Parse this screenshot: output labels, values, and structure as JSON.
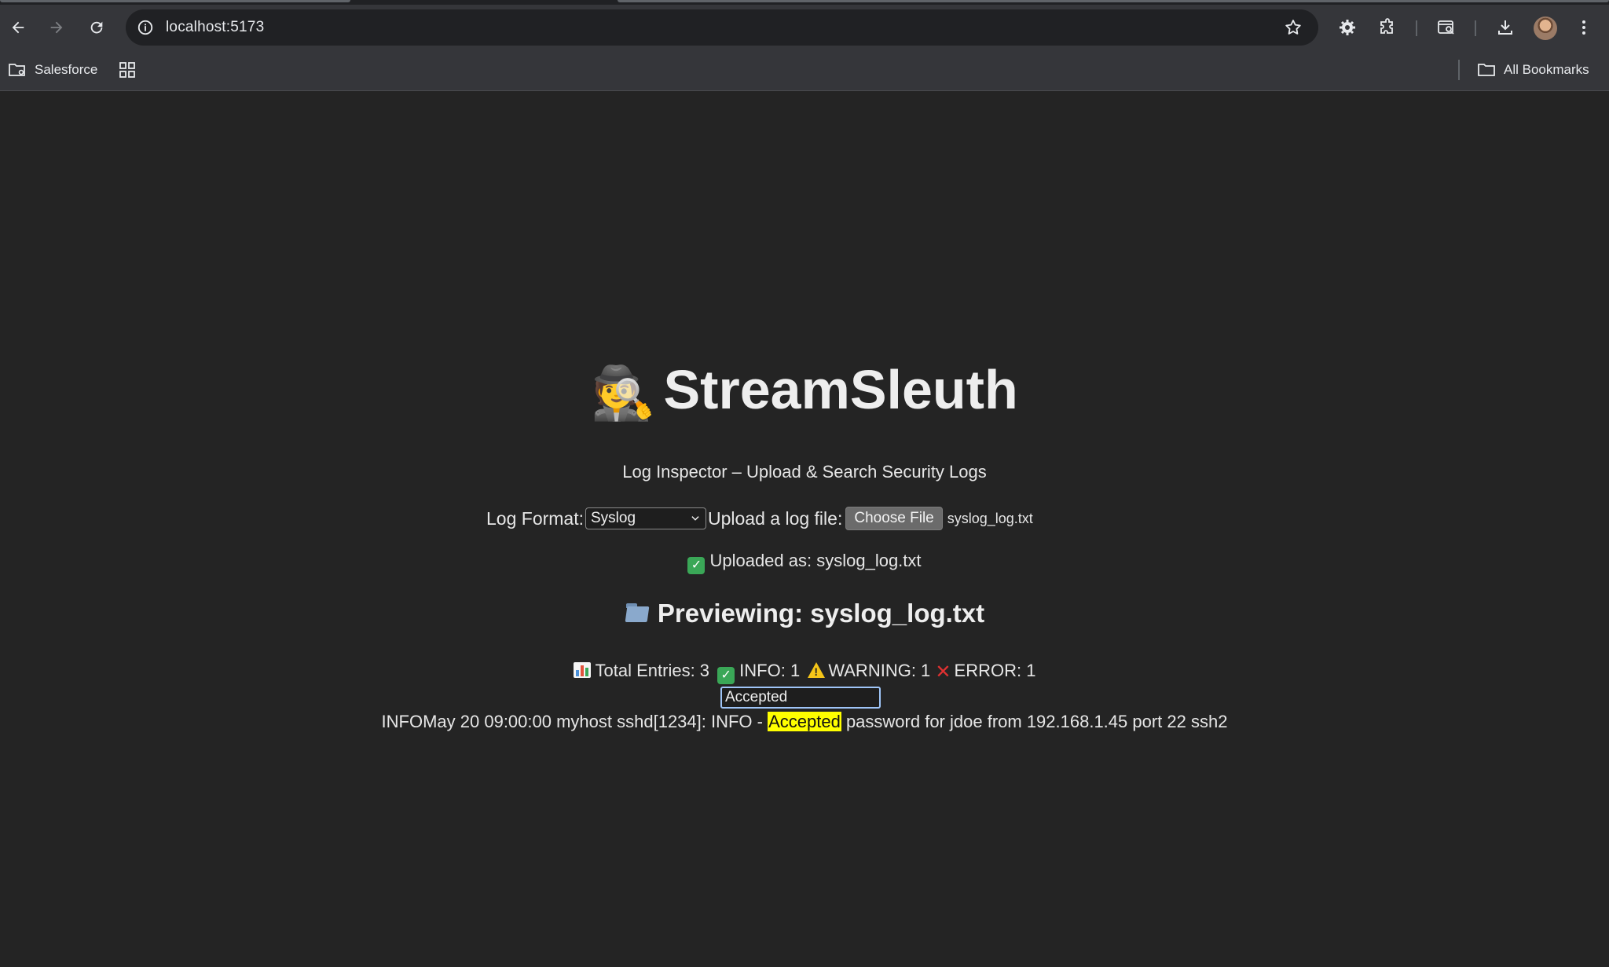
{
  "browser": {
    "url": "localhost:5173",
    "bookmarks": [
      {
        "label": "Salesforce",
        "icon": "folder-gear-icon"
      },
      {
        "label": "",
        "icon": "apps-grid-icon"
      }
    ],
    "all_bookmarks_label": "All Bookmarks"
  },
  "app": {
    "title_emoji": "🕵️",
    "title": "StreamSleuth",
    "subtitle": "Log Inspector – Upload & Search Security Logs"
  },
  "controls": {
    "format_label": "Log Format:",
    "format_value": "Syslog",
    "upload_label": "Upload a log file:",
    "choose_file_label": "Choose File",
    "file_name": "syslog_log.txt"
  },
  "upload_status": "Uploaded as: syslog_log.txt",
  "preview_title": "Previewing: syslog_log.txt",
  "stats": {
    "total": "Total Entries: 3",
    "info": "INFO: 1",
    "warning": "WARNING: 1",
    "error": "ERROR: 1"
  },
  "search": {
    "value": "Accepted"
  },
  "log_entries": [
    {
      "level": "INFO",
      "before": "May 20 09:00:00 myhost sshd[1234]: INFO - ",
      "match": "Accepted",
      "after": " password for jdoe from 192.168.1.45 port 22 ssh2"
    }
  ],
  "colors": {
    "page_bg": "#242424",
    "chrome_bg": "#35363a",
    "omnibox_bg": "#202124",
    "highlight": "#ffff00",
    "focus_ring": "#9fc5f8"
  }
}
